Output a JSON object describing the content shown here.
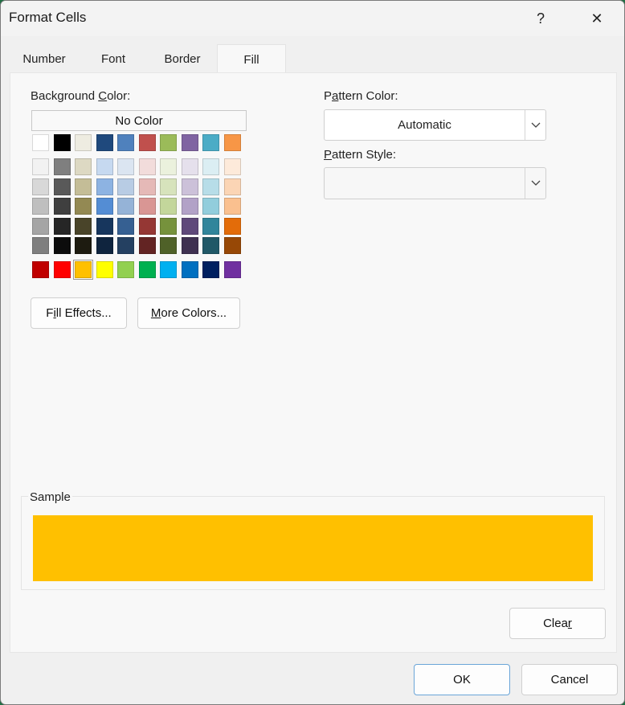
{
  "window": {
    "title": "Format Cells",
    "help_glyph": "?",
    "close_glyph": "✕"
  },
  "tabs": [
    {
      "label": "Number",
      "active": false
    },
    {
      "label": "Font",
      "active": false
    },
    {
      "label": "Border",
      "active": false
    },
    {
      "label": "Fill",
      "active": true
    }
  ],
  "background_color": {
    "label_pre": "Background ",
    "label_key": "C",
    "label_post": "olor:",
    "no_color_label": "No Color",
    "theme_row": [
      "#ffffff",
      "#000000",
      "#eeece1",
      "#1f497d",
      "#4f81bd",
      "#c0504d",
      "#9bbb59",
      "#8064a2",
      "#4bacc6",
      "#f79646"
    ],
    "tint_rows": [
      [
        "#f2f2f2",
        "#7f7f7f",
        "#ddd9c3",
        "#c6d9f0",
        "#dbe5f1",
        "#f2dcdb",
        "#ebf1dd",
        "#e5e0ec",
        "#dbeef3",
        "#fdeada"
      ],
      [
        "#d8d8d8",
        "#595959",
        "#c4bd97",
        "#8db3e2",
        "#b8cce4",
        "#e5b9b7",
        "#d7e3bc",
        "#ccc1d9",
        "#b7dde8",
        "#fbd5b5"
      ],
      [
        "#bfbfbf",
        "#3f3f3f",
        "#938953",
        "#548dd4",
        "#95b3d7",
        "#d99694",
        "#c3d69b",
        "#b2a2c7",
        "#92cddc",
        "#fac08f"
      ],
      [
        "#a5a5a5",
        "#262626",
        "#494429",
        "#17365d",
        "#366092",
        "#953734",
        "#76923c",
        "#5f497a",
        "#31859b",
        "#e36c09"
      ],
      [
        "#7f7f7f",
        "#0c0c0c",
        "#1d1b10",
        "#0f243e",
        "#244061",
        "#632423",
        "#4f6128",
        "#3f3151",
        "#205867",
        "#974806"
      ]
    ],
    "standard_row": [
      "#c00000",
      "#ff0000",
      "#ffc000",
      "#ffff00",
      "#92d050",
      "#00b050",
      "#00b0f0",
      "#0070c0",
      "#002060",
      "#7030a0"
    ],
    "selected_color": "#ffc000"
  },
  "buttons": {
    "fill_effects": {
      "pre": "F",
      "key": "i",
      "post": "ll Effects..."
    },
    "more_colors": {
      "pre": "",
      "key": "M",
      "post": "ore Colors..."
    },
    "clear": {
      "pre": "Clea",
      "key": "r",
      "post": ""
    },
    "ok": "OK",
    "cancel": "Cancel"
  },
  "pattern_color": {
    "label_pre": "P",
    "label_key": "a",
    "label_post": "ttern Color:",
    "value": "Automatic"
  },
  "pattern_style": {
    "label_pre": "",
    "label_key": "P",
    "label_post": "attern Style:",
    "value": ""
  },
  "sample": {
    "label": "Sample",
    "color": "#ffc000"
  }
}
